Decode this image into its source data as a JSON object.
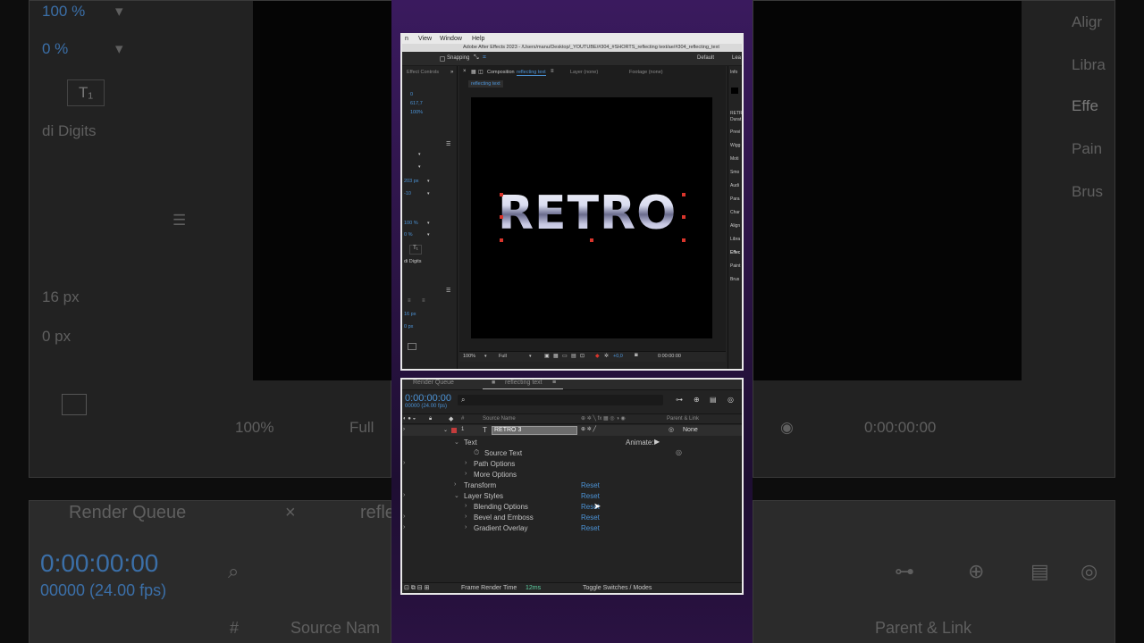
{
  "background": {
    "left": {
      "percent_value": "100 %",
      "zero_percent": "0 %",
      "text_icon": "T₁",
      "hindi_digits": "di Digits",
      "px_16": "16 px",
      "px_0": "0 px",
      "zoom": "100%",
      "resolution": "Full",
      "render_queue": "Render Queue",
      "close_x": "×",
      "comp_tab_partial": "refle",
      "timecode": "0:00:00:00",
      "fps_partial": "00000 (24.00 fps)",
      "col_hash": "#",
      "col_source": "Source Nam"
    },
    "right": {
      "items": [
        "Aligr",
        "Libra",
        "Effe",
        "Pain",
        "Brus"
      ],
      "timecode": "0:00:00:00",
      "parent_link": "Parent & Link"
    }
  },
  "ae_window": {
    "menu": [
      "n",
      "View",
      "Window",
      "Help"
    ],
    "title": "Adobe After Effects 2023 - /Users/manu/Desktop/_YOUTUBE/#304_#SHORTS_reflecting text/ae/#304_reflecting_text",
    "toolbar": {
      "snapping": "Snapping",
      "workspace": "Default",
      "workspace2": "Lea"
    },
    "left_panel": {
      "tab": "Effect Controls",
      "values": [
        "0",
        "617,7",
        "100%"
      ],
      "px_203": "203 px",
      "minus10": "-10",
      "percent100": "100 %",
      "percent0": "0 %",
      "t_icon": "T₁",
      "digits": "di Digits",
      "px16": "16 px",
      "px0": "0 px"
    },
    "comp_panel": {
      "close": "×",
      "comp_label": "Composition",
      "comp_name": "reflecting text",
      "layer_tab": "Layer (none)",
      "footage_tab": "Footage (none)",
      "breadcrumb": "reflecting text",
      "canvas_text": "RETRO",
      "zoom": "100%",
      "resolution": "Full",
      "exposure": "+0,0",
      "timecode": "0:00:00:00"
    },
    "right_panel": {
      "items": [
        "Info",
        "RETR",
        "Durat",
        "Previ",
        "Wigg",
        "Moti",
        "Smo",
        "Audi",
        "Para",
        "Char",
        "Align",
        "Libra",
        "Effec",
        "Paint",
        "Brus"
      ]
    }
  },
  "timeline": {
    "tabs": {
      "render_queue": "Render Queue",
      "comp_tab": "reflecting text"
    },
    "timecode": "0:00:00:00",
    "fps": "00000 (24.00 fps)",
    "columns": {
      "hash": "#",
      "source_name": "Source Name",
      "parent_link": "Parent & Link"
    },
    "layer": {
      "index": "1",
      "type_icon": "T",
      "name": "RETRO 3",
      "parent": "None"
    },
    "animate": "Animate:",
    "properties": [
      {
        "label": "Text",
        "level": 1,
        "reset": ""
      },
      {
        "label": "Source Text",
        "level": 3,
        "reset": ""
      },
      {
        "label": "Path Options",
        "level": 2,
        "reset": ""
      },
      {
        "label": "More Options",
        "level": 2,
        "reset": ""
      },
      {
        "label": "Transform",
        "level": 1,
        "reset": "Reset"
      },
      {
        "label": "Layer Styles",
        "level": 1,
        "reset": "Reset"
      },
      {
        "label": "Blending Options",
        "level": 2,
        "reset": "Reset"
      },
      {
        "label": "Bevel and Emboss",
        "level": 2,
        "reset": "Reset"
      },
      {
        "label": "Gradient Overlay",
        "level": 2,
        "reset": "Reset"
      }
    ],
    "footer": {
      "frame_render_label": "Frame Render Time",
      "frame_render_value": "12ms",
      "toggle": "Toggle Switches / Modes"
    }
  }
}
